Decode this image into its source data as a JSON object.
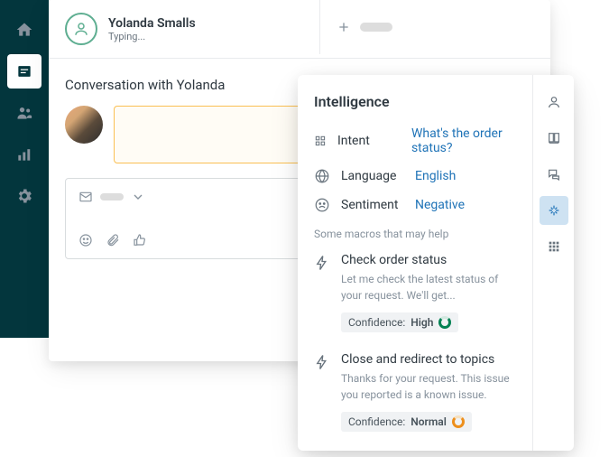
{
  "header": {
    "user_name": "Yolanda Smalls",
    "status": "Typing..."
  },
  "conversation": {
    "title": "Conversation with Yolanda"
  },
  "intelligence": {
    "title": "Intelligence",
    "intent": {
      "label": "Intent",
      "value": "What's the order status?"
    },
    "language": {
      "label": "Language",
      "value": "English"
    },
    "sentiment": {
      "label": "Sentiment",
      "value": "Negative"
    },
    "macros_hint": "Some macros that may help",
    "macros": [
      {
        "title": "Check order status",
        "desc": "Let me check the latest status of your request. We'll get...",
        "confidence_label": "Confidence:",
        "confidence_value": "High"
      },
      {
        "title": "Close and redirect to topics",
        "desc": "Thanks for your request. This issue you reported is a known issue.",
        "confidence_label": "Confidence:",
        "confidence_value": "Normal"
      }
    ]
  },
  "icons": {
    "home": "home-icon",
    "tickets": "tickets-icon",
    "customers": "customers-icon",
    "analytics": "analytics-icon",
    "settings": "settings-icon"
  }
}
